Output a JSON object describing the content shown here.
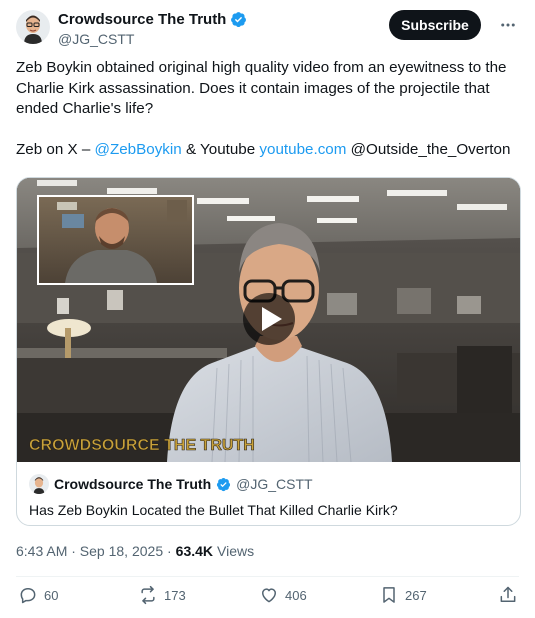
{
  "author": {
    "name": "Crowdsource The Truth",
    "handle": "@JG_CSTT",
    "subscribe_label": "Subscribe"
  },
  "tweet": {
    "paragraph1": "Zeb Boykin obtained original high quality video from an eyewitness to the Charlie Kirk assassination.  Does it contain images of the projectile that ended Charlie's life?",
    "p2_prefix": "Zeb on X – ",
    "p2_mention": "@ZebBoykin",
    "p2_middle": " & Youtube ",
    "p2_link": "youtube.com",
    "p2_suffix": " @Outside_the_Overton"
  },
  "media": {
    "watermark": "CROWDSOURCE THE TRUTH",
    "play_icon": "play-icon"
  },
  "quote": {
    "name": "Crowdsource The Truth",
    "handle": "@JG_CSTT",
    "text": "Has Zeb Boykin Located the Bullet That Killed Charlie Kirk?"
  },
  "meta": {
    "time": "6:43 AM · Sep 18, 2025 ·",
    "views_count": "63.4K",
    "views_label": "Views"
  },
  "actions": {
    "replies": "60",
    "reposts": "173",
    "likes": "406",
    "bookmarks": "267"
  },
  "colors": {
    "accent": "#1d9bf0",
    "text": "#0f1419",
    "muted": "#536471"
  }
}
